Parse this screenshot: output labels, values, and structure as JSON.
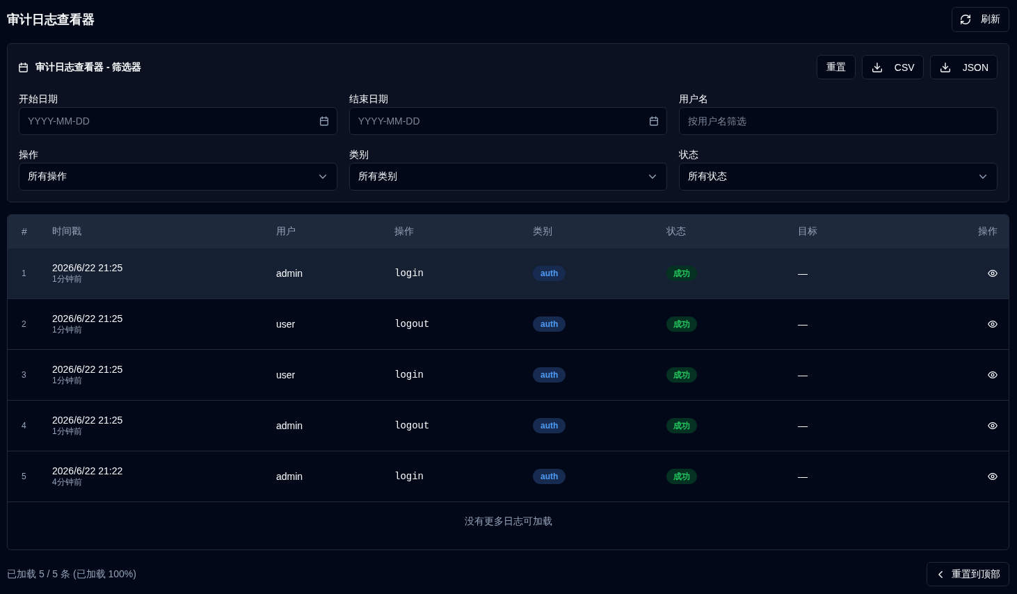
{
  "header": {
    "title": "审计日志查看器",
    "refresh_button": "刷新"
  },
  "filters": {
    "title": "审计日志查看器 - 筛选器",
    "buttons": [
      {
        "label": "重置",
        "kind": "plain"
      },
      {
        "label": "CSV",
        "kind": "download"
      },
      {
        "label": "JSON",
        "kind": "download"
      }
    ],
    "fields": [
      {
        "label": "开始日期",
        "kind": "date",
        "placeholder": "YYYY-MM-DD"
      },
      {
        "label": "结束日期",
        "kind": "date",
        "placeholder": "YYYY-MM-DD"
      },
      {
        "label": "用户名",
        "kind": "text",
        "placeholder": "按用户名筛选"
      },
      {
        "label": "操作",
        "kind": "select",
        "value": "所有操作"
      },
      {
        "label": "类别",
        "kind": "select",
        "value": "所有类别"
      },
      {
        "label": "状态",
        "kind": "select",
        "value": "所有状态"
      }
    ]
  },
  "table": {
    "columns": [
      "#",
      "时间戳",
      "用户",
      "操作",
      "类别",
      "状态",
      "目标",
      "操作"
    ],
    "rows": [
      {
        "index": "1",
        "timestamp": "2026/6/22 21:25",
        "relative_time": "1分钟前",
        "user": "admin",
        "action": "login",
        "category": "auth",
        "status": "成功",
        "target": "—",
        "selected": true
      },
      {
        "index": "2",
        "timestamp": "2026/6/22 21:25",
        "relative_time": "1分钟前",
        "user": "user",
        "action": "logout",
        "category": "auth",
        "status": "成功",
        "target": "—",
        "selected": false
      },
      {
        "index": "3",
        "timestamp": "2026/6/22 21:25",
        "relative_time": "1分钟前",
        "user": "user",
        "action": "login",
        "category": "auth",
        "status": "成功",
        "target": "—",
        "selected": false
      },
      {
        "index": "4",
        "timestamp": "2026/6/22 21:25",
        "relative_time": "1分钟前",
        "user": "admin",
        "action": "logout",
        "category": "auth",
        "status": "成功",
        "target": "—",
        "selected": false
      },
      {
        "index": "5",
        "timestamp": "2026/6/22 21:22",
        "relative_time": "4分钟前",
        "user": "admin",
        "action": "login",
        "category": "auth",
        "status": "成功",
        "target": "—",
        "selected": false
      }
    ],
    "footer": "没有更多日志可加载"
  },
  "status_bar": {
    "summary": "已加载 5 / 5 条 (已加载 100%)",
    "back_to_top_button": "重置到顶部"
  }
}
